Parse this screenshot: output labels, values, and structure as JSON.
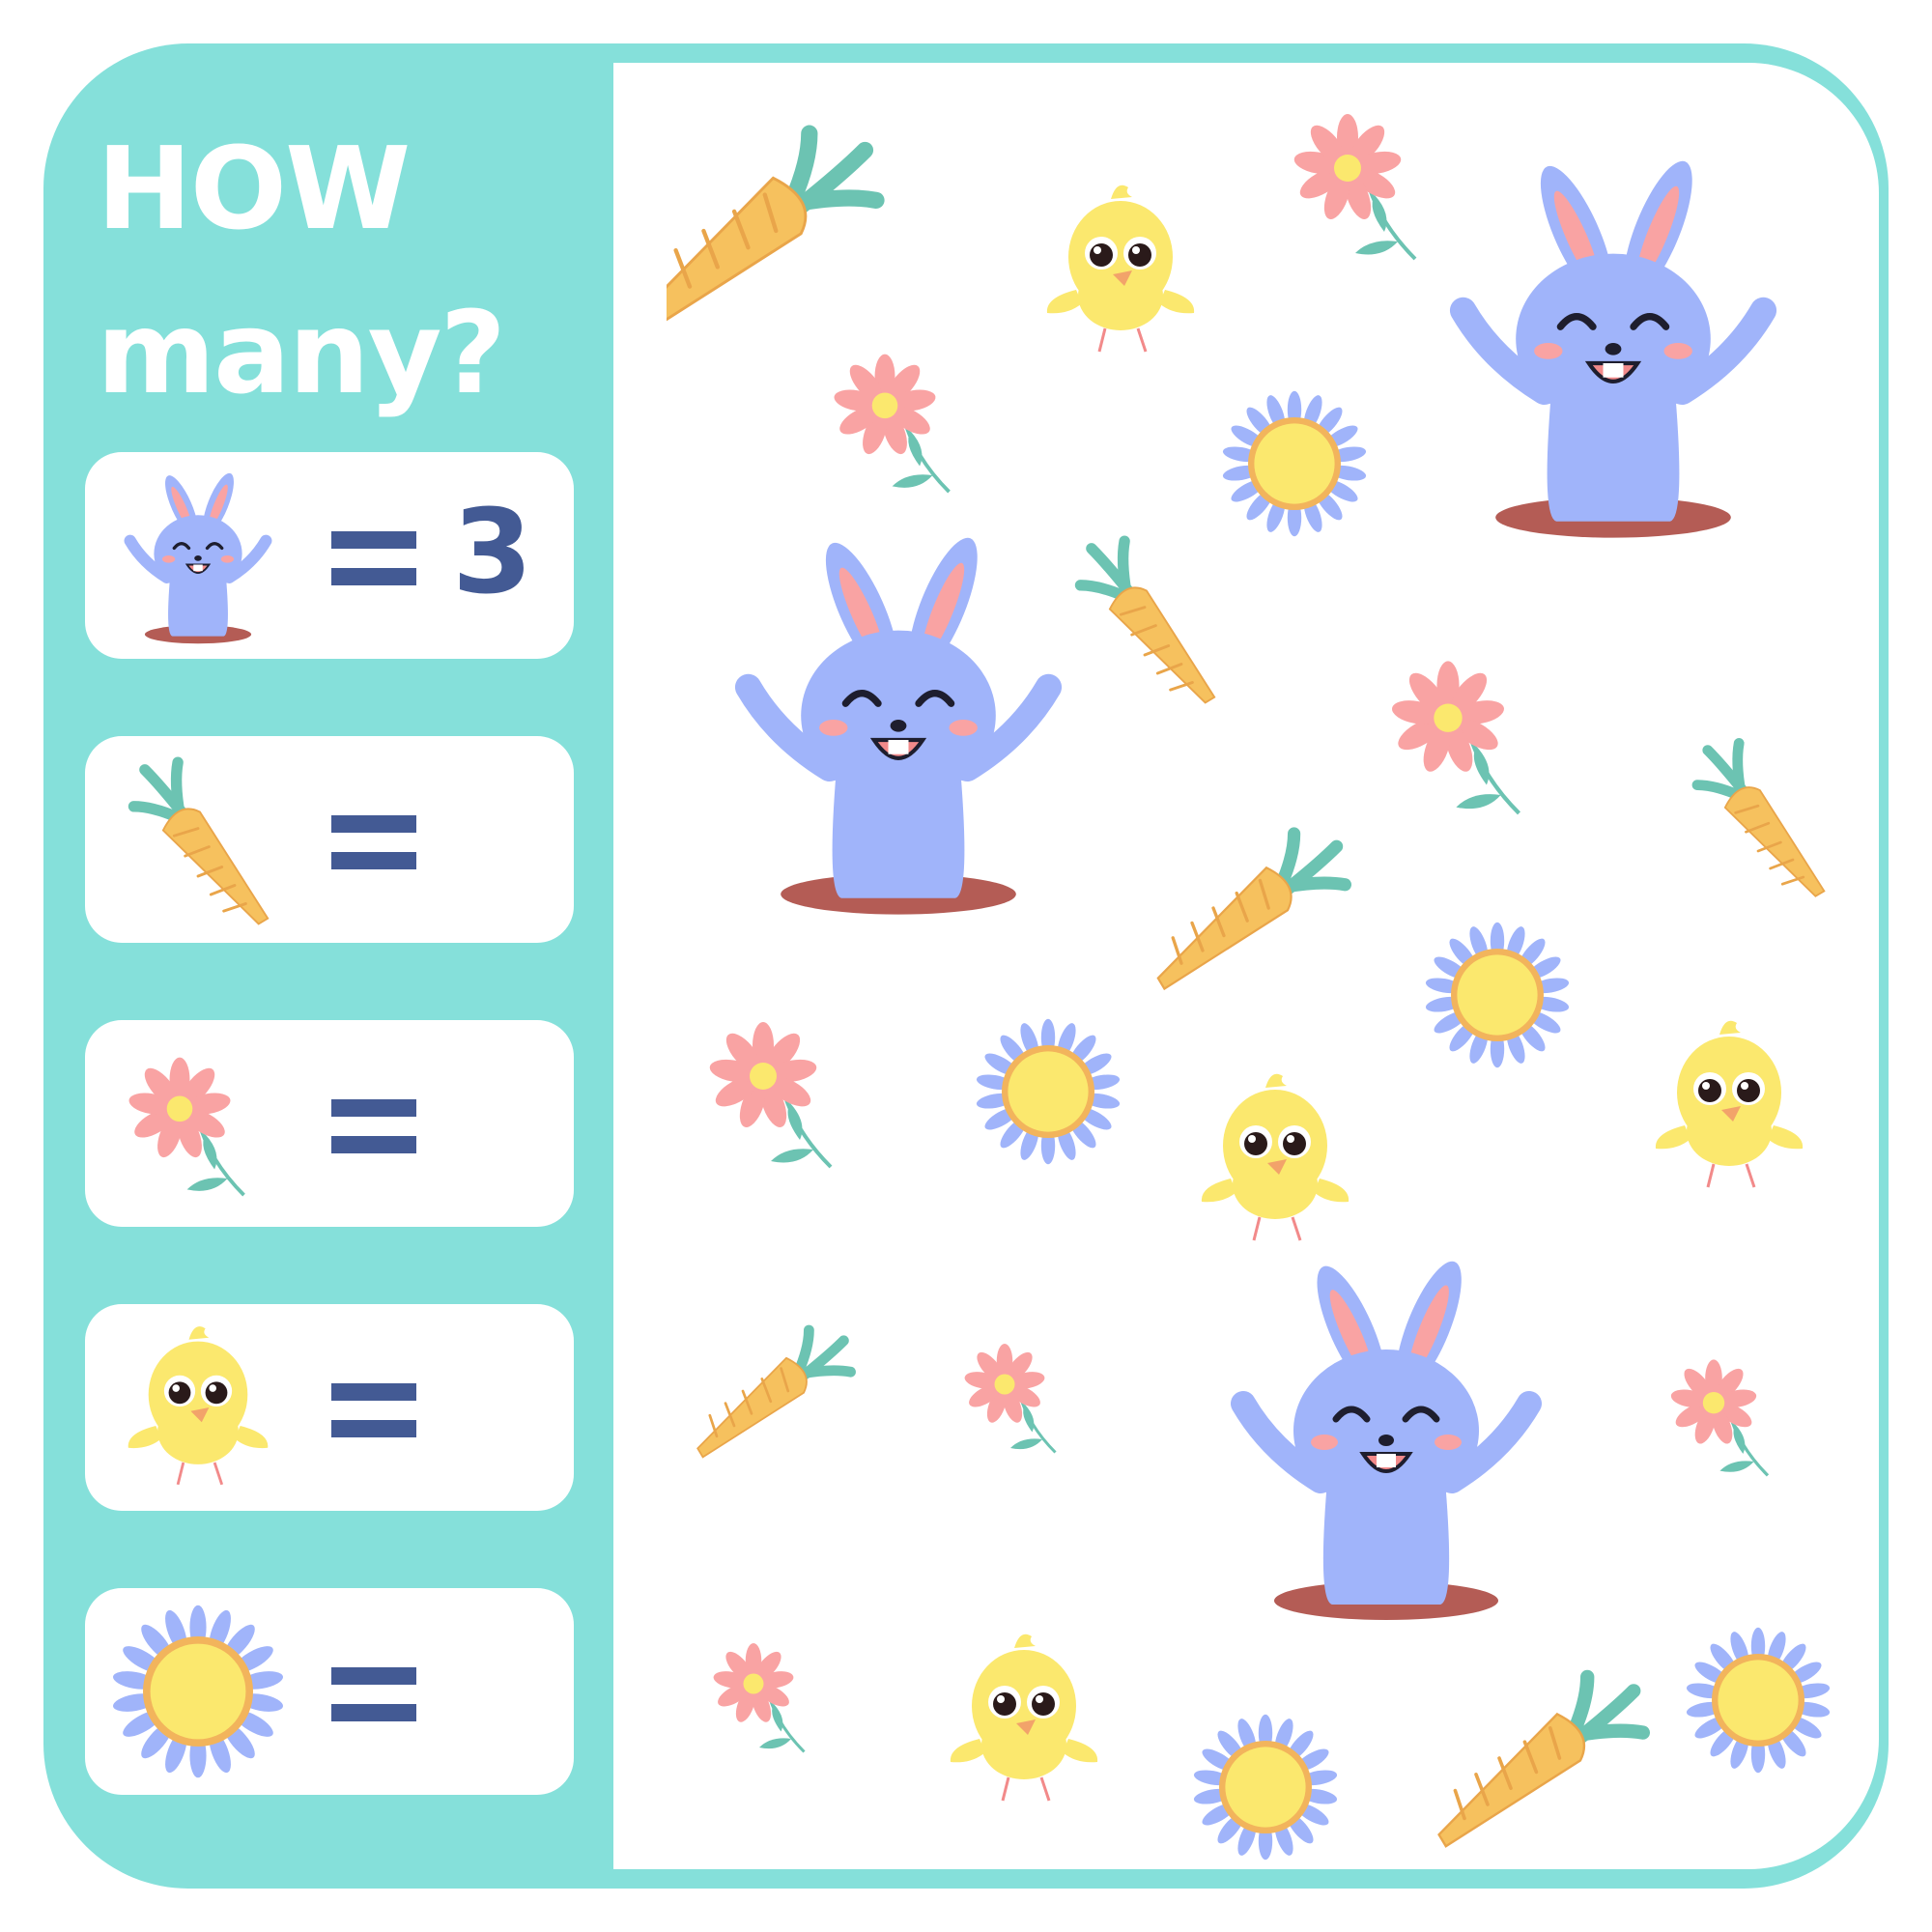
{
  "title": {
    "line1": "HOW",
    "line2": "many?"
  },
  "colors": {
    "frame": "#85e0da",
    "board": "#ffffff",
    "equals": "#435a94",
    "bunny": "#a0b4fa",
    "carrot": "#f6c15e",
    "flower_pink": "#f9a3a3",
    "chick": "#fbe86e",
    "sunflower_petal": "#a0b4fa",
    "sunflower_center": "#fbe86e"
  },
  "counting_rows": [
    {
      "item": "bunny-icon",
      "answer": "3"
    },
    {
      "item": "carrot-icon",
      "answer": ""
    },
    {
      "item": "pink-flower-icon",
      "answer": ""
    },
    {
      "item": "chick-icon",
      "answer": ""
    },
    {
      "item": "blue-sunflower-icon",
      "answer": ""
    }
  ]
}
